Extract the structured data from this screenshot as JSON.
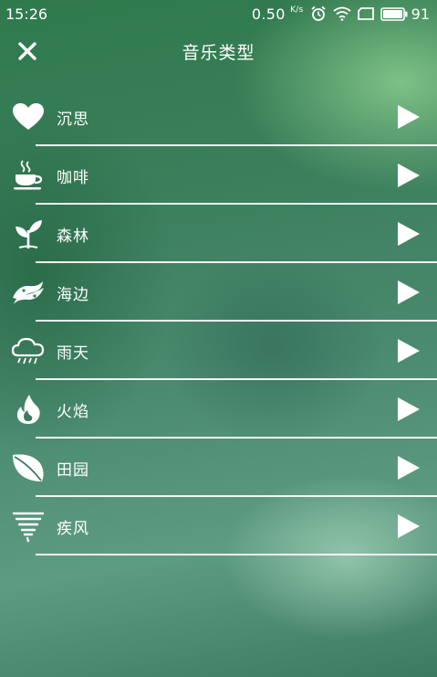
{
  "status_bar": {
    "time": "15:26",
    "net_speed": "0.50",
    "net_unit": "K/s",
    "battery": "91"
  },
  "header": {
    "title": "音乐类型"
  },
  "categories": [
    {
      "label": "沉思",
      "icon": "heart-icon"
    },
    {
      "label": "咖啡",
      "icon": "coffee-cup-icon"
    },
    {
      "label": "森林",
      "icon": "sprout-icon"
    },
    {
      "label": "海边",
      "icon": "wave-icon"
    },
    {
      "label": "雨天",
      "icon": "rain-cloud-icon"
    },
    {
      "label": "火焰",
      "icon": "flame-icon"
    },
    {
      "label": "田园",
      "icon": "leaf-icon"
    },
    {
      "label": "疾风",
      "icon": "tornado-icon"
    }
  ]
}
